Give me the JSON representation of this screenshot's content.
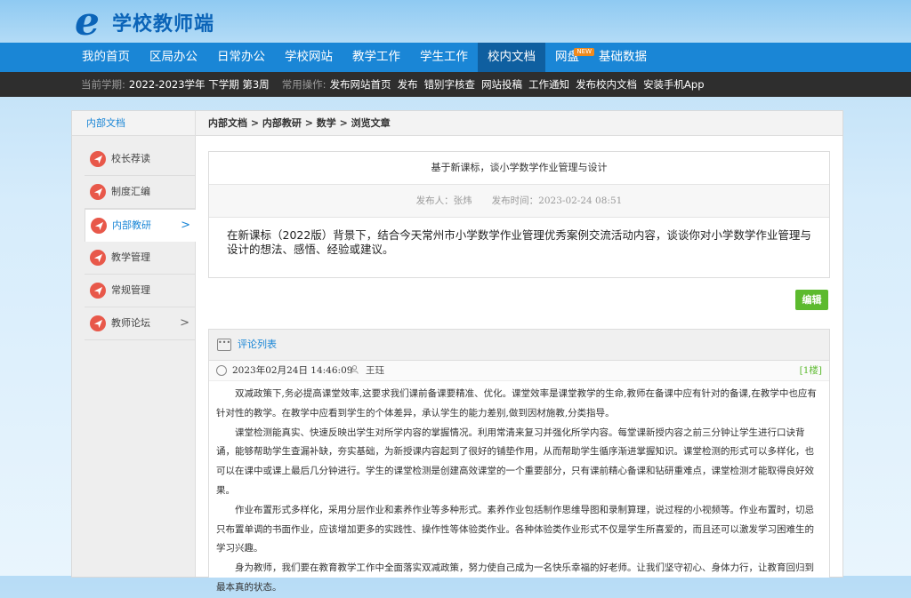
{
  "brand": {
    "logo_letter": "e",
    "name": "学校教师端"
  },
  "nav": {
    "items": [
      {
        "label": "我的首页"
      },
      {
        "label": "区局办公"
      },
      {
        "label": "日常办公"
      },
      {
        "label": "学校网站"
      },
      {
        "label": "教学工作"
      },
      {
        "label": "学生工作"
      },
      {
        "label": "校内文档",
        "active": true
      },
      {
        "label": "网盘",
        "badge": "NEW"
      },
      {
        "label": "基础数据"
      }
    ]
  },
  "subnav": {
    "term_label": "当前学期:",
    "term_value": "2022-2023学年 下学期 第3周",
    "ops_label": "常用操作:",
    "ops": [
      "发布网站首页",
      "发布",
      "错别字核查",
      "网站投稿",
      "工作通知",
      "发布校内文档",
      "安装手机App"
    ]
  },
  "panel": {
    "left_title": "内部文档",
    "breadcrumb": "内部文档 > 内部教研 > 数学 > 浏览文章"
  },
  "sidebar": {
    "items": [
      {
        "label": "校长荐读",
        "arrow": ""
      },
      {
        "label": "制度汇编",
        "arrow": ""
      },
      {
        "label": "内部教研",
        "arrow": ">",
        "active": true
      },
      {
        "label": "教学管理",
        "arrow": ""
      },
      {
        "label": "常规管理",
        "arrow": ""
      },
      {
        "label": "教师论坛",
        "arrow": ">"
      }
    ]
  },
  "article": {
    "title": "基于新课标，谈小学数学作业管理与设计",
    "publisher_label": "发布人：",
    "publisher": "张炜",
    "time_label": "发布时间：",
    "time": "2023-02-24 08:51",
    "body": "在新课标（2022版）背景下，结合今天常州市小学数学作业管理优秀案例交流活动内容，谈谈你对小学数学作业管理与设计的想法、感悟、经验或建议。"
  },
  "edit_button": "编辑",
  "comments": {
    "title": "评论列表",
    "dots_icon": "•••",
    "items": [
      {
        "date": "2023年02月24日  14:46:09",
        "user": "王珏",
        "floor": "[1楼]",
        "paragraphs": [
          "双减政策下,务必提高课堂效率,这要求我们课前备课要精准、优化。课堂效率是课堂教学的生命,教师在备课中应有针对的备课,在教学中也应有针对性的教学。在教学中应看到学生的个体差异，承认学生的能力差别,做到因材施教,分类指导。",
          "课堂检测能真实、快速反映出学生对所学内容的掌握情况。利用常清来复习并强化所学内容。每堂课新授内容之前三分钟让学生进行口诀背诵，能够帮助学生查漏补缺，夯实基础，为新授课内容起到了很好的铺垫作用，从而帮助学生循序渐进掌握知识。课堂检测的形式可以多样化，也可以在课中或课上最后几分钟进行。学生的课堂检测是创建高效课堂的一个重要部分，只有课前精心备课和钻研重难点，课堂检测才能取得良好效果。",
          "作业布置形式多样化，采用分层作业和素养作业等多种形式。素养作业包括制作思维导图和录制算理，说过程的小视频等。作业布置时，切忌只布置单调的书面作业，应该增加更多的实践性、操作性等体验类作业。各种体验类作业形式不仅是学生所喜爱的，而且还可以激发学习困难生的学习兴趣。",
          "身为教师，我们要在教育教学工作中全面落实双减政策，努力使自己成为一名快乐幸福的好老师。让我们坚守初心、身体力行，让教育回归到最本真的状态。"
        ]
      }
    ]
  },
  "colors": {
    "nav": "#1a86d6",
    "nav_active": "#0f5fa0",
    "subnav": "#2e2e2e",
    "edit": "#5cba2e",
    "side_icon": "#e8584a"
  }
}
